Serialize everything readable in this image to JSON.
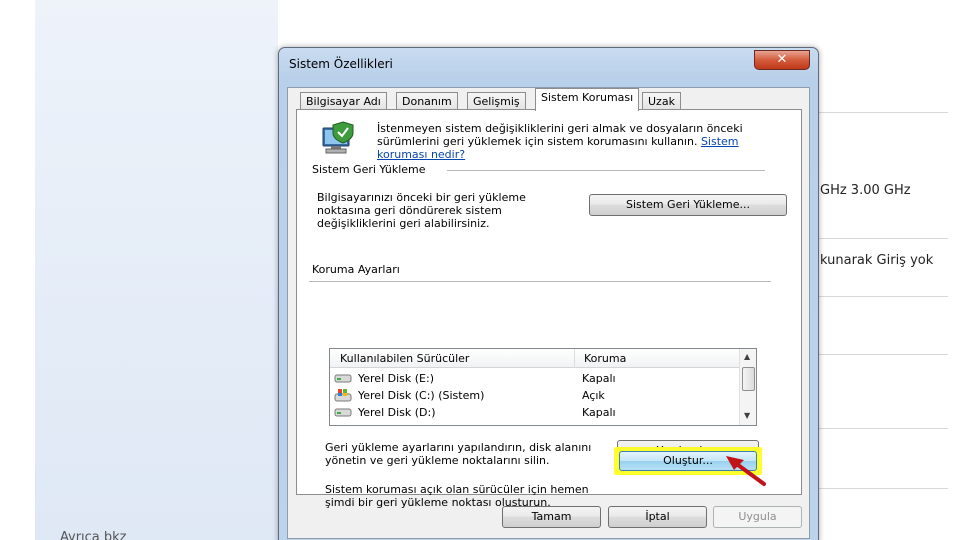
{
  "background": {
    "ghz_text": "GHz   3.00 GHz",
    "pen_text": "kunarak Giriş yok",
    "bottom_text": "Ayrıca bkz"
  },
  "dialog": {
    "title": "Sistem Özellikleri",
    "close_label": "✕",
    "tabs": [
      {
        "label": "Bilgisayar Adı",
        "active": false
      },
      {
        "label": "Donanım",
        "active": false
      },
      {
        "label": "Gelişmiş",
        "active": false
      },
      {
        "label": "Sistem Koruması",
        "active": true
      },
      {
        "label": "Uzak",
        "active": false
      }
    ],
    "intro_text": "İstenmeyen sistem değişikliklerini geri almak ve dosyaların önceki sürümlerini geri yüklemek için sistem korumasını kullanın. ",
    "intro_link": "Sistem koruması nedir?",
    "restore_group": {
      "label": "Sistem Geri Yükleme",
      "text": "Bilgisayarınızı önceki bir geri yükleme noktasına geri döndürerek sistem değişikliklerini geri alabilirsiniz.",
      "button": "Sistem Geri Yükleme..."
    },
    "protection_group": {
      "label": "Koruma Ayarları",
      "columns": [
        "Kullanılabilen Sürücüler",
        "Koruma"
      ],
      "rows": [
        {
          "drive": "Yerel Disk (E:)",
          "status": "Kapalı",
          "icon": "drive-icon"
        },
        {
          "drive": "Yerel Disk (C:) (Sistem)",
          "status": "Açık",
          "icon": "system-drive-icon"
        },
        {
          "drive": "Yerel Disk (D:)",
          "status": "Kapalı",
          "icon": "drive-icon"
        }
      ],
      "configure_text": "Geri yükleme ayarlarını yapılandırın, disk alanını yönetin ve geri yükleme noktalarını silin.",
      "configure_button": "Yapılandır...",
      "create_text": "Sistem koruması açık olan sürücüler için hemen şimdi bir geri yükleme noktası oluşturun.",
      "create_button": "Oluştur..."
    },
    "footer": {
      "ok": "Tamam",
      "cancel": "İptal",
      "apply": "Uygula"
    }
  },
  "colors": {
    "highlight": "#ffff2b",
    "arrow": "#c0141a",
    "link": "#0645ad"
  }
}
